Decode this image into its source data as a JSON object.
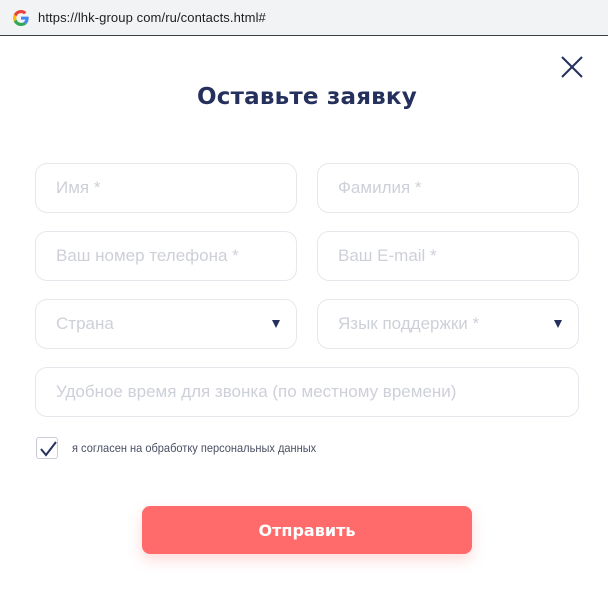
{
  "browser": {
    "url": "https://lhk-group com/ru/contacts.html#",
    "favicon_icon": "google-g-icon"
  },
  "form": {
    "title": "Оставьте заявку",
    "close_icon": "close-icon",
    "fields": {
      "first_name": "Имя *",
      "last_name": "Фамилия *",
      "phone": "Ваш номер телефона *",
      "email": "Ваш E-mail *",
      "country": "Страна",
      "support_language": "Язык поддержки *",
      "call_time": "Удобное время для звонка (по местному времени)"
    },
    "consent": {
      "checked": true,
      "label": "я согласен на обработку персональных данных"
    },
    "submit_label": "Отправить"
  },
  "colors": {
    "accent": "#ff6b6b",
    "title": "#25305c",
    "placeholder": "#cdd0d8",
    "border": "#e6e7ec"
  }
}
